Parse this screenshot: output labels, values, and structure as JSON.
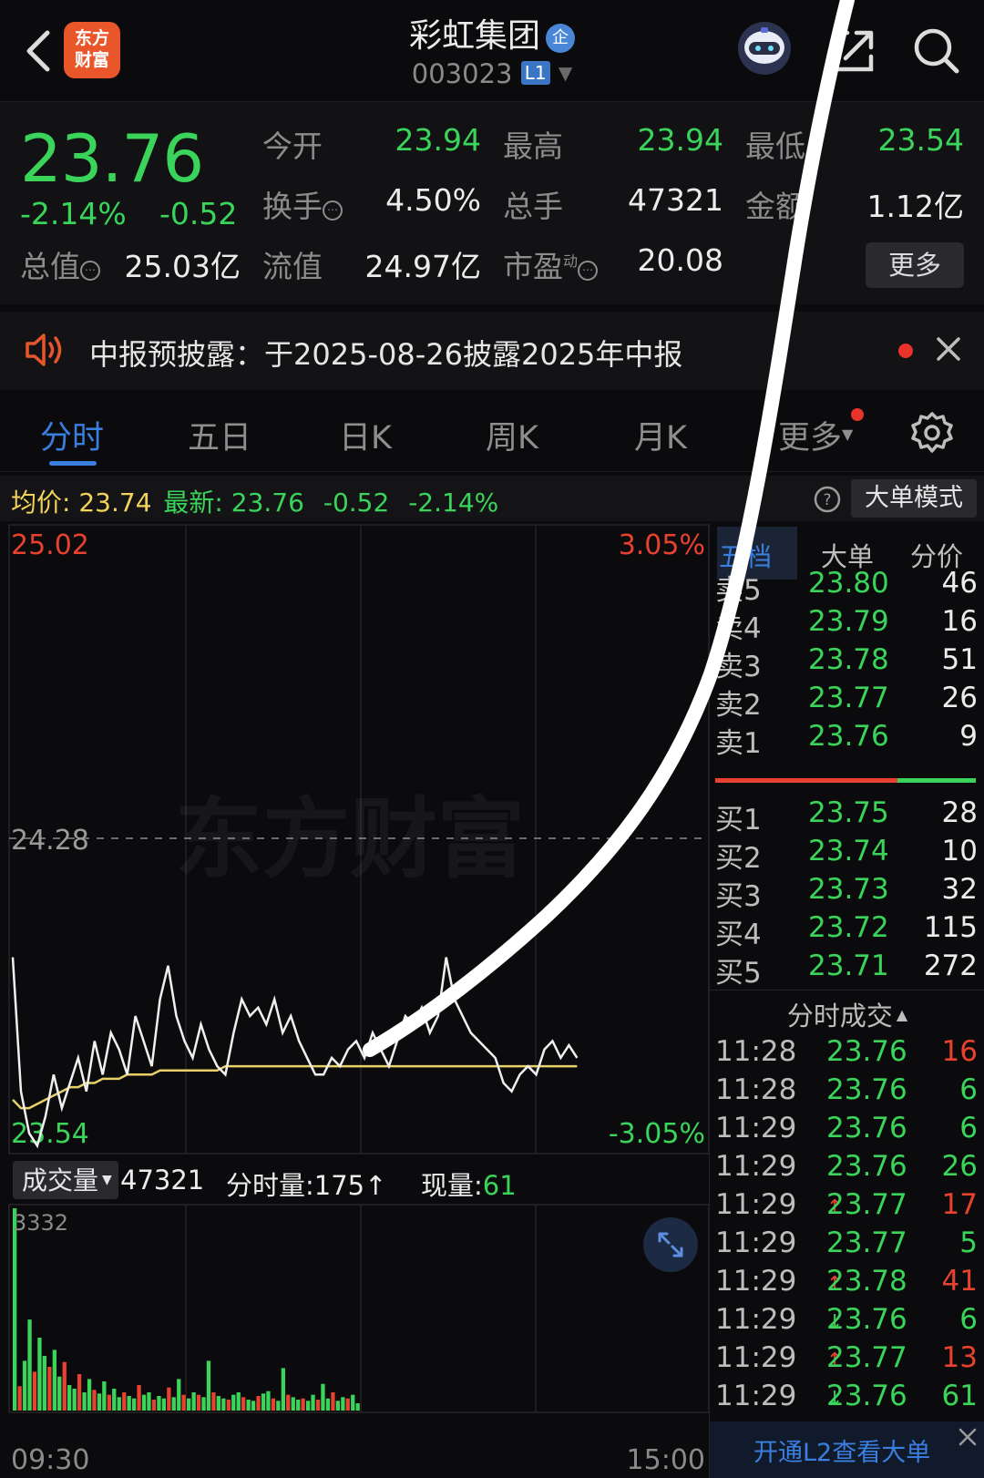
{
  "header": {
    "title": "彩虹集团",
    "ent_badge": "企",
    "code": "003023",
    "level_badge": "L1",
    "logo_line1": "东方",
    "logo_line2": "财富"
  },
  "quote": {
    "price": "23.76",
    "pct": "-2.14%",
    "change": "-0.52",
    "open_label": "今开",
    "open": "23.94",
    "high_label": "最高",
    "high": "23.94",
    "low_label": "最低",
    "low": "23.54",
    "turnover_label": "换手",
    "turnover": "4.50%",
    "volume_label": "总手",
    "volume": "47321",
    "amount_label": "金额",
    "amount": "1.12亿",
    "mktcap_label": "总值",
    "mktcap": "25.03亿",
    "float_label": "流值",
    "float_cap": "24.97亿",
    "pe_label": "市盈",
    "pe_sup": "动",
    "pe": "20.08",
    "more_label": "更多"
  },
  "notice": {
    "text": "中报预披露：于2025-08-26披露2025年中报"
  },
  "tabs": [
    {
      "label": "分时"
    },
    {
      "label": "五日"
    },
    {
      "label": "日K"
    },
    {
      "label": "周K"
    },
    {
      "label": "月K"
    },
    {
      "label": "更多"
    }
  ],
  "priceline": {
    "avg_label": "均价:",
    "avg": "23.74",
    "last_label": "最新:",
    "last": "23.76",
    "chg": "-0.52",
    "pct": "-2.14%",
    "big_order_label": "大单模式"
  },
  "chart": {
    "top_price": "25.02",
    "top_pct": "3.05%",
    "mid_price": "24.28",
    "bottom_price": "23.54",
    "bottom_pct": "-3.05%",
    "watermark": "东方财富"
  },
  "volume": {
    "selector_label": "成交量",
    "total": "47321",
    "minute_vol": "分时量:175↑",
    "current_label": "现量:",
    "current": "61",
    "max_label": "3332",
    "time_start": "09:30",
    "time_end": "15:00"
  },
  "orderbook": {
    "tabs": [
      "五档",
      "大单",
      "分价"
    ],
    "asks": [
      {
        "label": "卖5",
        "price": "23.80",
        "qty": "46"
      },
      {
        "label": "卖4",
        "price": "23.79",
        "qty": "16"
      },
      {
        "label": "卖3",
        "price": "23.78",
        "qty": "51"
      },
      {
        "label": "卖2",
        "price": "23.77",
        "qty": "26"
      },
      {
        "label": "卖1",
        "price": "23.76",
        "qty": "9"
      }
    ],
    "bids": [
      {
        "label": "买1",
        "price": "23.75",
        "qty": "28"
      },
      {
        "label": "买2",
        "price": "23.74",
        "qty": "10"
      },
      {
        "label": "买3",
        "price": "23.73",
        "qty": "32"
      },
      {
        "label": "买4",
        "price": "23.72",
        "qty": "115"
      },
      {
        "label": "买5",
        "price": "23.71",
        "qty": "272"
      }
    ],
    "ratio_sell": 0.7
  },
  "trades": {
    "title": "分时成交",
    "rows": [
      {
        "time": "11:28",
        "price": "23.76",
        "arrow": "",
        "qty": "16",
        "qty_color": "#e8412f"
      },
      {
        "time": "11:28",
        "price": "23.76",
        "arrow": "",
        "qty": "6",
        "qty_color": "#3bd45a"
      },
      {
        "time": "11:29",
        "price": "23.76",
        "arrow": "",
        "qty": "6",
        "qty_color": "#3bd45a"
      },
      {
        "time": "11:29",
        "price": "23.76",
        "arrow": "",
        "qty": "26",
        "qty_color": "#3bd45a"
      },
      {
        "time": "11:29",
        "price": "23.77",
        "arrow": "↑",
        "qty": "17",
        "qty_color": "#e8412f"
      },
      {
        "time": "11:29",
        "price": "23.77",
        "arrow": "",
        "qty": "5",
        "qty_color": "#3bd45a"
      },
      {
        "time": "11:29",
        "price": "23.78",
        "arrow": "↑",
        "qty": "41",
        "qty_color": "#e8412f"
      },
      {
        "time": "11:29",
        "price": "23.76",
        "arrow": "↓",
        "qty": "6",
        "qty_color": "#3bd45a"
      },
      {
        "time": "11:29",
        "price": "23.77",
        "arrow": "↑",
        "qty": "13",
        "qty_color": "#e8412f"
      },
      {
        "time": "11:29",
        "price": "23.76",
        "arrow": "↓",
        "qty": "61",
        "qty_color": "#3bd45a"
      }
    ],
    "l2_link": "开通L2查看大单"
  },
  "colors": {
    "up": "#e8412f",
    "down": "#3bd45a",
    "avg_line": "#e8d068",
    "accent": "#3a7fe0"
  },
  "chart_data": {
    "type": "line",
    "ylim": [
      23.54,
      25.02
    ],
    "ref_price": 24.28,
    "x_start": "09:30",
    "x_end": "15:00",
    "series": [
      {
        "values": [
          24.0,
          23.68,
          23.58,
          23.55,
          23.62,
          23.72,
          23.64,
          23.7,
          23.76,
          23.68,
          23.8,
          23.72,
          23.82,
          23.78,
          23.72,
          23.86,
          23.8,
          23.74,
          23.9,
          23.98,
          23.86,
          23.8,
          23.76,
          23.84,
          23.78,
          23.74,
          23.72,
          23.82,
          23.9,
          23.86,
          23.88,
          23.84,
          23.9,
          23.82,
          23.86,
          23.8,
          23.76,
          23.72,
          23.72,
          23.76,
          23.74,
          23.78,
          23.8,
          23.76,
          23.82,
          23.78,
          23.74,
          23.8,
          23.86,
          23.84,
          23.88,
          23.82,
          23.86,
          24.0,
          23.9,
          23.86,
          23.82,
          23.8,
          23.78,
          23.76,
          23.7,
          23.68,
          23.72,
          23.74,
          23.72,
          23.78,
          23.8,
          23.76,
          23.79,
          23.76
        ]
      },
      {
        "values": [
          23.66,
          23.64,
          23.64,
          23.65,
          23.66,
          23.67,
          23.68,
          23.69,
          23.69,
          23.7,
          23.7,
          23.71,
          23.71,
          23.71,
          23.72,
          23.72,
          23.72,
          23.72,
          23.73,
          23.73,
          23.73,
          23.73,
          23.73,
          23.73,
          23.73,
          23.73,
          23.74,
          23.74,
          23.74,
          23.74,
          23.74,
          23.74,
          23.74,
          23.74,
          23.74,
          23.74,
          23.74,
          23.74,
          23.74,
          23.74,
          23.74,
          23.74,
          23.74,
          23.74,
          23.74,
          23.74,
          23.74,
          23.74,
          23.74,
          23.74,
          23.74,
          23.74,
          23.74,
          23.74,
          23.74,
          23.74,
          23.74,
          23.74,
          23.74,
          23.74,
          23.74,
          23.74,
          23.74,
          23.74,
          23.74,
          23.74,
          23.74,
          23.74,
          23.74,
          23.74
        ]
      }
    ],
    "volume": [
      3332,
      400,
      820,
      1500,
      640,
      1200,
      900,
      720,
      1000,
      560,
      800,
      420,
      360,
      600,
      300,
      520,
      340,
      280,
      480,
      260,
      360,
      220,
      300,
      240,
      200,
      420,
      260,
      300,
      180,
      240,
      200,
      380,
      220,
      520,
      260,
      200,
      300,
      260,
      220,
      820,
      300,
      240,
      200,
      180,
      260,
      300,
      220,
      180,
      160,
      240,
      280,
      320,
      200,
      160,
      700,
      260,
      220,
      180,
      200,
      160,
      260,
      180,
      440,
      200,
      300,
      160,
      220,
      200,
      260,
      120
    ]
  }
}
